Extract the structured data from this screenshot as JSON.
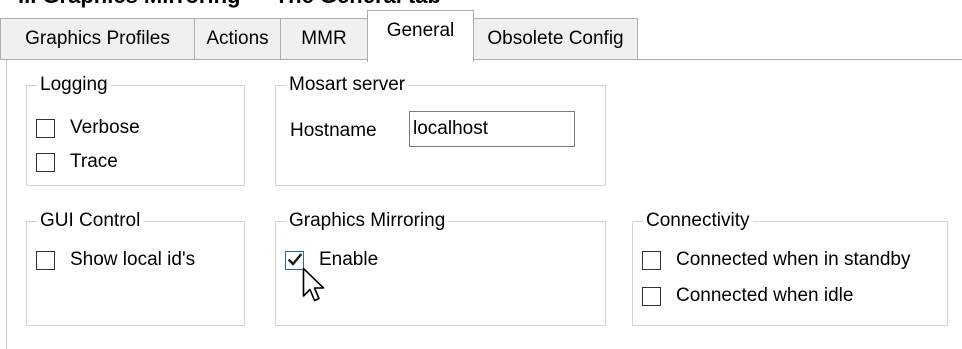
{
  "page_heading": "... Graphics Mirroring — The General tab",
  "tabs": [
    {
      "label": "Graphics Profiles",
      "active": false
    },
    {
      "label": "Actions",
      "active": false
    },
    {
      "label": "MMR",
      "active": false
    },
    {
      "label": "General",
      "active": true
    },
    {
      "label": "Obsolete Config",
      "active": false
    }
  ],
  "logging": {
    "title": "Logging",
    "options": [
      {
        "label": "Verbose",
        "checked": false
      },
      {
        "label": "Trace",
        "checked": false
      }
    ]
  },
  "mosart_server": {
    "title": "Mosart server",
    "hostname_label": "Hostname",
    "hostname_value": "localhost"
  },
  "gui_control": {
    "title": "GUI Control",
    "options": [
      {
        "label": "Show local id's",
        "checked": false
      }
    ]
  },
  "graphics_mirroring": {
    "title": "Graphics Mirroring",
    "options": [
      {
        "label": "Enable",
        "checked": true
      }
    ]
  },
  "connectivity": {
    "title": "Connectivity",
    "options": [
      {
        "label": "Connected when in standby",
        "checked": false
      },
      {
        "label": "Connected when idle",
        "checked": false
      }
    ]
  },
  "icons": {
    "checkmark": "checkmark-icon",
    "cursor": "mouse-pointer-icon"
  },
  "colors": {
    "tab_border": "#adadad",
    "tab_inactive_bg": "#f0f0f0",
    "group_border": "#d5d5d5",
    "checkbox_checked_border": "#2b65b5",
    "checkmark": "#1a1a1a"
  }
}
